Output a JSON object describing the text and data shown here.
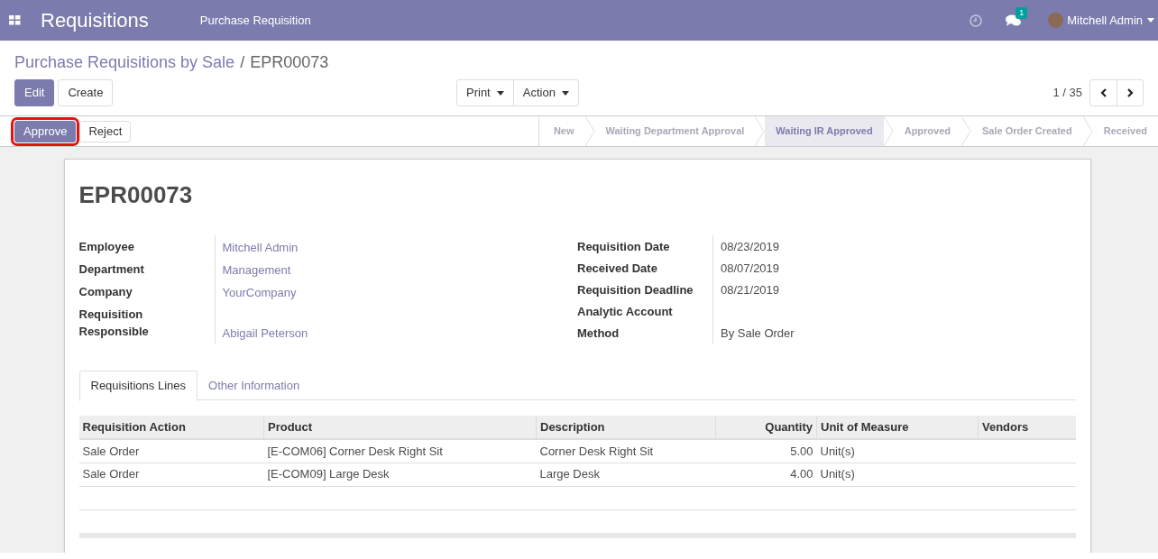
{
  "navbar": {
    "app_title": "Requisitions",
    "menu": [
      "Purchase Requisition"
    ],
    "message_count": "1",
    "user": "Mitchell Admin"
  },
  "breadcrumb": {
    "parent": "Purchase Requisitions by Sale",
    "separator": "/",
    "current": "EPR00073"
  },
  "control_buttons": [
    {
      "label": "Edit",
      "primary": true
    },
    {
      "label": "Create",
      "primary": false
    }
  ],
  "dropdowns": [
    "Print",
    "Action"
  ],
  "pager": "1 / 35",
  "header_buttons": [
    {
      "label": "Approve",
      "primary": true,
      "highlighted": true
    },
    {
      "label": "Reject",
      "primary": false,
      "highlighted": false
    }
  ],
  "stages": [
    {
      "label": "New",
      "selected": false
    },
    {
      "label": "Waiting Department Approval",
      "selected": false
    },
    {
      "label": "Waiting IR Approved",
      "selected": true
    },
    {
      "label": "Approved",
      "selected": false
    },
    {
      "label": "Sale Order Created",
      "selected": false
    },
    {
      "label": "Received",
      "selected": false
    }
  ],
  "record_title": "EPR00073",
  "left_fields": [
    {
      "label": "Employee",
      "value": "Mitchell Admin",
      "kind": "link"
    },
    {
      "label": "Department",
      "value": "Management",
      "kind": "link"
    },
    {
      "label": "Company",
      "value": "YourCompany",
      "kind": "link"
    },
    {
      "label": "Requisition Responsible",
      "value": "Abigail Peterson",
      "kind": "link"
    }
  ],
  "right_fields": [
    {
      "label": "Requisition Date",
      "value": "08/23/2019",
      "kind": "text"
    },
    {
      "label": "Received Date",
      "value": "08/07/2019",
      "kind": "text"
    },
    {
      "label": "Requisition Deadline",
      "value": "08/21/2019",
      "kind": "text"
    },
    {
      "label": "Analytic Account",
      "kind": "empty"
    },
    {
      "label": "Method",
      "value": "By Sale Order",
      "kind": "text"
    }
  ],
  "tabs": [
    {
      "label": "Requisitions Lines",
      "selected": true
    },
    {
      "label": "Other Information",
      "selected": false
    }
  ],
  "table": {
    "columns": [
      "Requisition Action",
      "Product",
      "Description",
      "Quantity",
      "Unit of Measure",
      "Vendors"
    ],
    "rows": [
      [
        "Sale Order",
        "[E-COM06] Corner Desk Right Sit",
        "Corner Desk Right Sit",
        "5.00",
        "Unit(s)",
        ""
      ],
      [
        "Sale Order",
        "[E-COM09] Large Desk",
        "Large Desk",
        "4.00",
        "Unit(s)",
        ""
      ]
    ]
  }
}
